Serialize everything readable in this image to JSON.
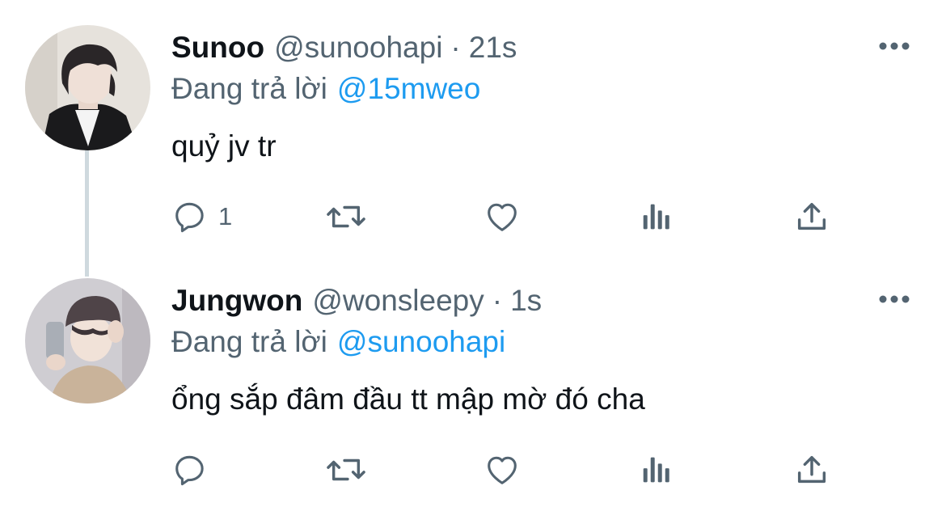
{
  "tweets": [
    {
      "display_name": "Sunoo",
      "handle": "@sunoohapi",
      "separator": "·",
      "time": "21s",
      "reply_prefix": "Đang trả lời",
      "reply_to": "@15mweo",
      "text": "quỷ jv tr",
      "reply_count": "1",
      "avatar_colors": {
        "bg": "#e6e2dc",
        "hair": "#2a2628",
        "skin": "#efe0d7",
        "jacket": "#1a1a1c"
      }
    },
    {
      "display_name": "Jungwon",
      "handle": "@wonsleepy",
      "separator": "·",
      "time": "1s",
      "reply_prefix": "Đang trả lời",
      "reply_to": "@sunoohapi",
      "text": "ổng sắp đâm đầu tt mập mờ đó cha",
      "reply_count": "",
      "avatar_colors": {
        "bg": "#cfcdd2",
        "beanie": "#4f4448",
        "skin": "#f1e2d8",
        "jacket": "#c9b39a",
        "phone": "#a9aeb6"
      }
    }
  ],
  "icons": {
    "reply": "reply-icon",
    "retweet": "retweet-icon",
    "like": "heart-icon",
    "views": "views-icon",
    "share": "share-icon",
    "more": "more-icon"
  },
  "colors": {
    "text": "#0f1419",
    "secondary": "#536471",
    "accent": "#1d9bf0",
    "thread_line": "#cfd9de"
  }
}
